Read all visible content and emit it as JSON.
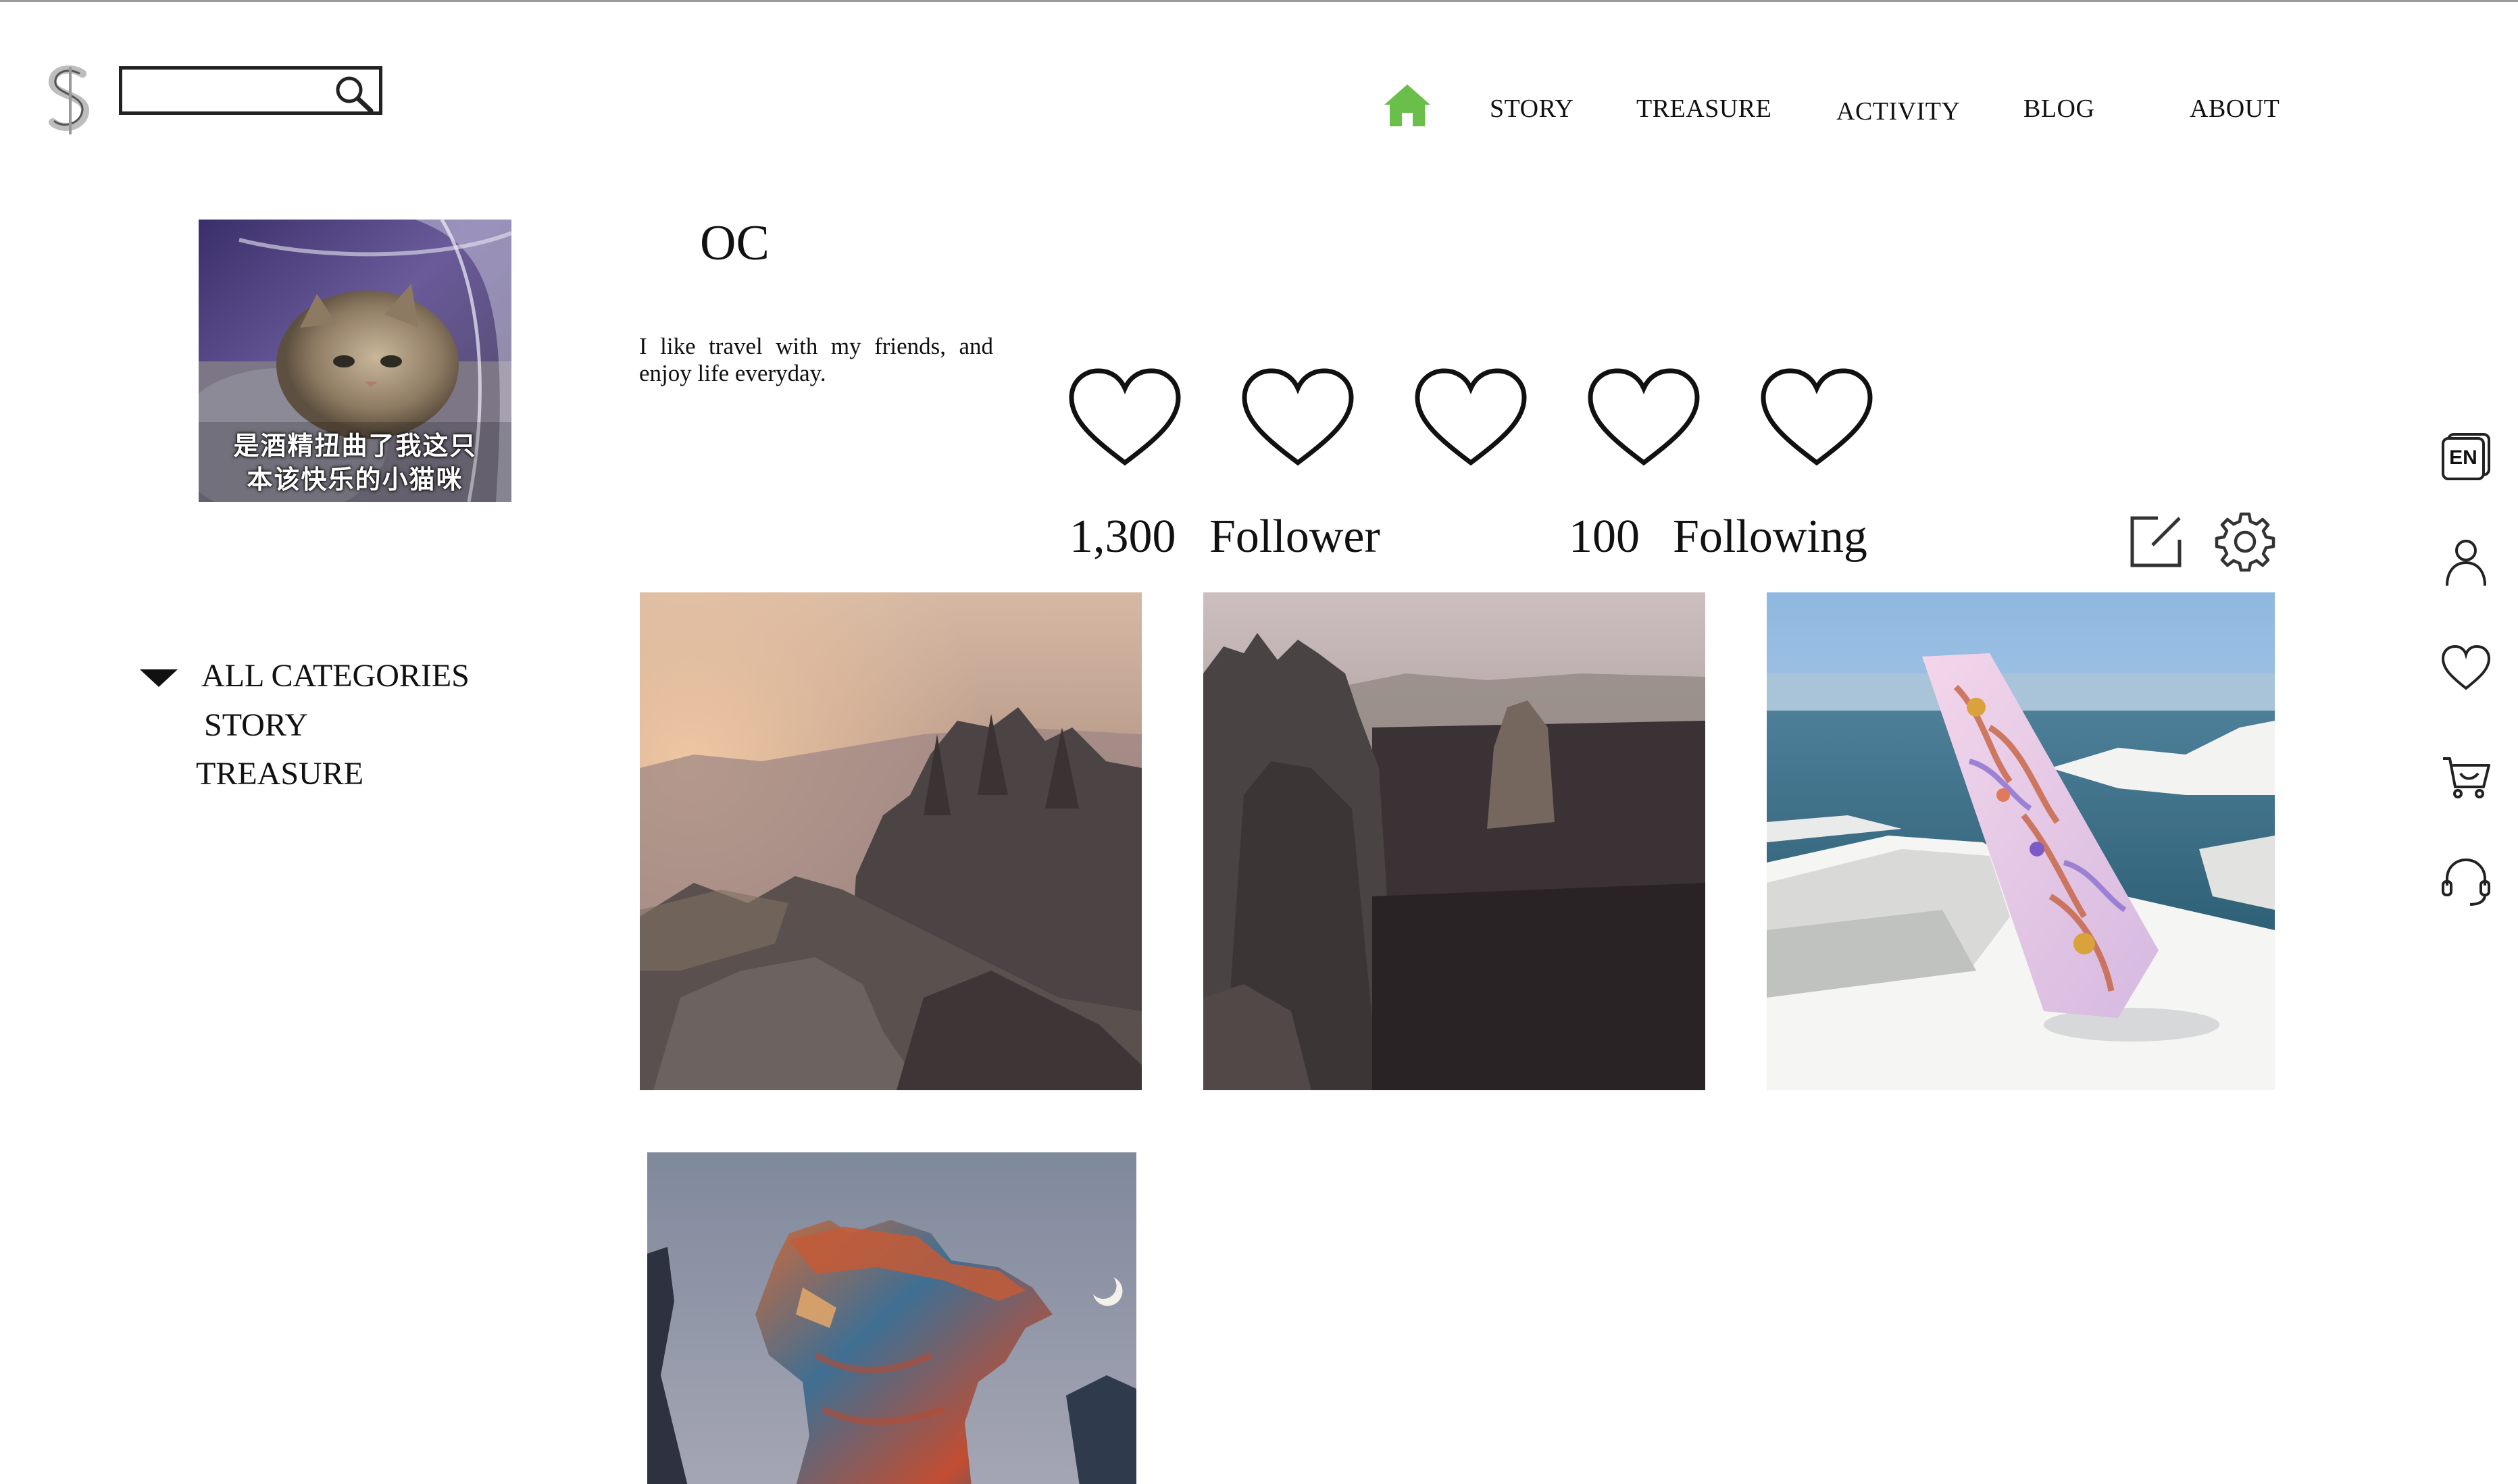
{
  "header": {
    "search_placeholder": "",
    "nav": [
      {
        "label": "STORY"
      },
      {
        "label": "TREASURE"
      },
      {
        "label": "ACTIVITY"
      },
      {
        "label": "BLOG"
      },
      {
        "label": "ABOUT"
      }
    ],
    "home_icon": "home-icon",
    "home_color": "#6abf4b"
  },
  "profile": {
    "avatar_caption_line1": "是酒精扭曲了我这只",
    "avatar_caption_line2": "本该快乐的小猫咪",
    "username": "OC",
    "bio": "I like travel with my friends, and enjoy life everyday.",
    "followers_count": "1,300",
    "followers_label": "Follower",
    "following_count": "100",
    "following_label": "Following",
    "hearts": 5
  },
  "sidebar": {
    "categories_header": "ALL CATEGORIES",
    "items": [
      {
        "label": "STORY"
      },
      {
        "label": "TREASURE"
      }
    ]
  },
  "posts": [
    {
      "subject": "misty rocky mountain peaks at sunrise"
    },
    {
      "subject": "rock towers above dark forest valley"
    },
    {
      "subject": "printed scarf on white seaside rocks"
    },
    {
      "subject": "colorful rock pillar with crescent moon"
    }
  ],
  "right_rail": {
    "language": "EN",
    "icons": [
      "language-icon",
      "user-icon",
      "heart-icon",
      "cart-icon",
      "support-headset-icon"
    ]
  }
}
